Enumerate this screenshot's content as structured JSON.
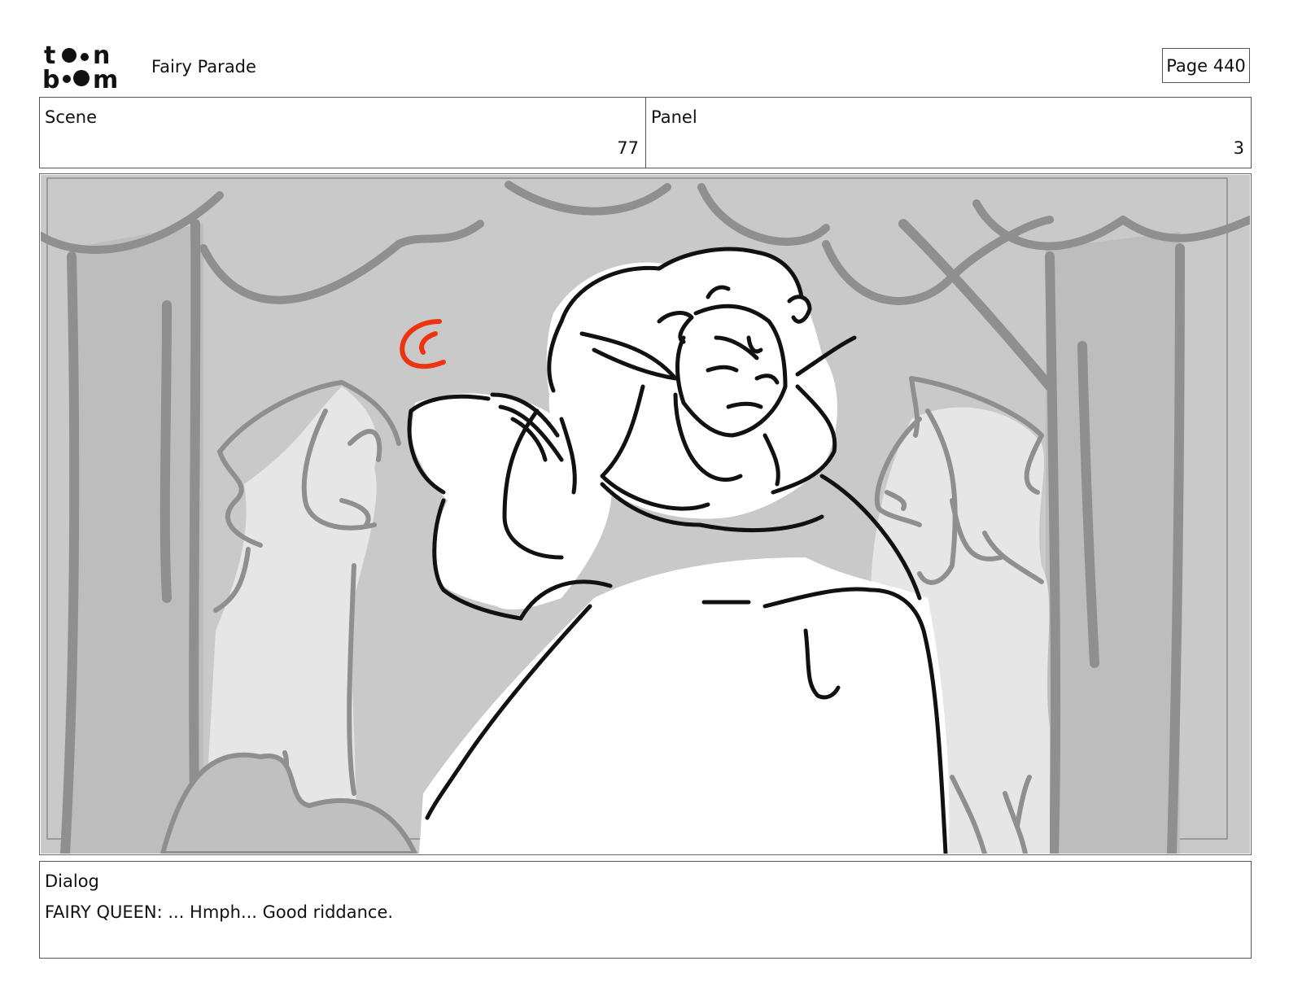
{
  "header": {
    "logo_text": "toon boom",
    "project_title": "Fairy Parade",
    "page_label": "Page 440"
  },
  "scene": {
    "label": "Scene",
    "value": "77"
  },
  "panel": {
    "label": "Panel",
    "value": "3"
  },
  "dialog": {
    "label": "Dialog",
    "text": "FAIRY QUEEN: ... Hmph... Good riddance."
  },
  "colors": {
    "sketch_line": "#111111",
    "background_gray": "#c9c9c9",
    "curtain_stroke": "#8f8f8f",
    "accent_red": "#ee3311"
  }
}
